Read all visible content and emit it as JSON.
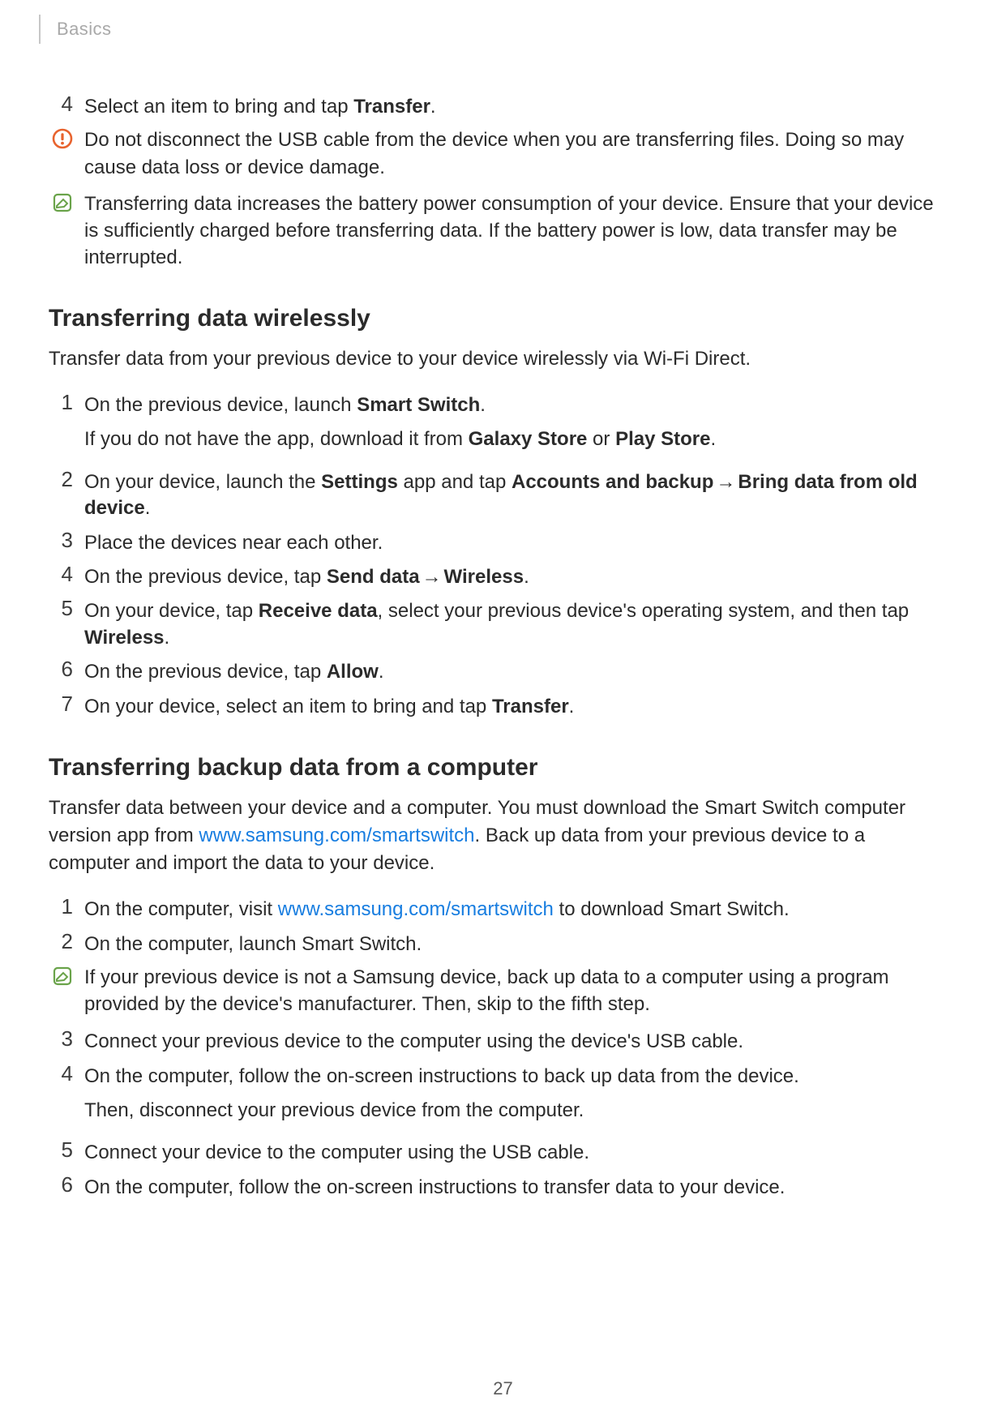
{
  "breadcrumb": "Basics",
  "page_number": "27",
  "arrow": "→",
  "top_step": {
    "num": "4",
    "pre": "Select an item to bring and tap ",
    "bold": "Transfer",
    "post": "."
  },
  "warning": {
    "text": "Do not disconnect the USB cable from the device when you are transferring files. Doing so may cause data loss or device damage."
  },
  "note1": {
    "text": "Transferring data increases the battery power consumption of your device. Ensure that your device is sufficiently charged before transferring data. If the battery power is low, data transfer may be interrupted."
  },
  "wireless": {
    "heading": "Transferring data wirelessly",
    "intro": "Transfer data from your previous device to your device wirelessly via Wi-Fi Direct.",
    "s1": {
      "num": "1",
      "l1_pre": "On the previous device, launch ",
      "l1_b": "Smart Switch",
      "l1_post": ".",
      "l2_pre": "If you do not have the app, download it from ",
      "l2_b1": "Galaxy Store",
      "l2_mid": " or ",
      "l2_b2": "Play Store",
      "l2_post": "."
    },
    "s2": {
      "num": "2",
      "pre": "On your device, launch the ",
      "b1": "Settings",
      "mid1": " app and tap ",
      "b2": "Accounts and backup",
      "b3": "Bring data from old device",
      "post": "."
    },
    "s3": {
      "num": "3",
      "text": "Place the devices near each other."
    },
    "s4": {
      "num": "4",
      "pre": "On the previous device, tap ",
      "b1": "Send data",
      "b2": "Wireless",
      "post": "."
    },
    "s5": {
      "num": "5",
      "pre": "On your device, tap ",
      "b1": "Receive data",
      "mid": ", select your previous device's operating system, and then tap ",
      "b2": "Wireless",
      "post": "."
    },
    "s6": {
      "num": "6",
      "pre": "On the previous device, tap ",
      "b1": "Allow",
      "post": "."
    },
    "s7": {
      "num": "7",
      "pre": "On your device, select an item to bring and tap ",
      "b1": "Transfer",
      "post": "."
    }
  },
  "computer": {
    "heading": "Transferring backup data from a computer",
    "intro_pre": "Transfer data between your device and a computer. You must download the Smart Switch computer version app from ",
    "intro_link": "www.samsung.com/smartswitch",
    "intro_post": ". Back up data from your previous device to a computer and import the data to your device.",
    "s1": {
      "num": "1",
      "pre": "On the computer, visit ",
      "link": "www.samsung.com/smartswitch",
      "post": " to download Smart Switch."
    },
    "s2": {
      "num": "2",
      "text": "On the computer, launch Smart Switch."
    },
    "note": {
      "text": "If your previous device is not a Samsung device, back up data to a computer using a program provided by the device's manufacturer. Then, skip to the fifth step."
    },
    "s3": {
      "num": "3",
      "text": "Connect your previous device to the computer using the device's USB cable."
    },
    "s4": {
      "num": "4",
      "l1": "On the computer, follow the on-screen instructions to back up data from the device.",
      "l2": "Then, disconnect your previous device from the computer."
    },
    "s5": {
      "num": "5",
      "text": "Connect your device to the computer using the USB cable."
    },
    "s6": {
      "num": "6",
      "text": "On the computer, follow the on-screen instructions to transfer data to your device."
    }
  }
}
